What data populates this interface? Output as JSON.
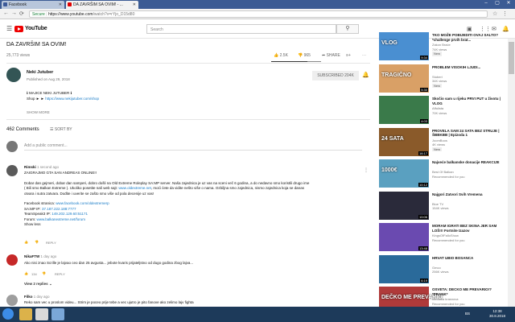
{
  "browser": {
    "tabs": [
      {
        "label": "Facebook",
        "fav": "#3b5998"
      },
      {
        "label": "DA ZAVRŠIM SA OVIM! - ...",
        "fav": "#e00000"
      }
    ],
    "address": {
      "secure": "Secure",
      "host": "https://www.youtube.com",
      "path": "/watch?v=rYjo_D15d80"
    }
  },
  "header": {
    "brand": "YouTube",
    "search_placeholder": "Search"
  },
  "video": {
    "title": "DA ZAVRŠIM SA OVIM!",
    "views": "25,773 views",
    "likes": "2.5K",
    "dislikes": "965",
    "share": "SHARE",
    "save": "SAVE",
    "like_ratio": 0.72
  },
  "channel": {
    "name": "Neki Jutuber",
    "published": "Published on Aug 29, 2018",
    "subscribe": "SUBSCRIBED",
    "subs": "204K"
  },
  "description": {
    "line1": "ℹ MAJICE NEKI JUTUBER ℹ",
    "line2_prefix": "Shop ► ►",
    "line2_link": "https://www.nekijutuber.com/shop",
    "show_more": "SHOW MORE"
  },
  "comments": {
    "count": "462 Comments",
    "sort": "SORT BY",
    "add_placeholder": "Add a public comment...",
    "items": [
      {
        "author": "Rimski",
        "time": "1 second ago",
        "lines": [
          "ZAIGRAJMO GTA SAN ANDREAS ONLINE!!",
          "",
          "Dobar dan gejmeri, dobar dan samperi, dobro došli na Old Extreme Roleplay SA:MP server. Naša zajednica je uz vas na sceni več 6 godina, a do nedavno smo koristili drugo ime",
          "( Bili smo Balkan Extreme ). Ukoliko posetite naš web sajt:",
          "otvara i sutra zatvara. Dođite i uverite se zašto smo više od pola decenije uz vas!"
        ],
        "web_link": "www.oldextreme.net",
        "line4_suffix": ", moći ćete da vidite nešto više o nama. Ozbiljna smo zajednica, nismo zajednica koja se danas",
        "fb_label": "Facebook stranica:",
        "fb_link": "www.facebook.com/oldextremerp",
        "ip_label": "SA:MP IP:",
        "ip_link": "37.187.222.188:7777",
        "ts_label": "TeamSpeak3 IP:",
        "ts_link": "149.202.129.60:51171",
        "forum_label": "Forum:",
        "forum_link": "www.balkanextreme.net/forum",
        "show_less": "Show less",
        "reply": "REPLY"
      },
      {
        "author": "NikaFTW",
        "time": "1 day ago",
        "text": "Ako nisi znao Scrille je lajvao ceo dan 25 avgusta... jebote kvaris prijateljstvo od dugo godina zbog lajva...",
        "likes": "134",
        "reply": "REPLY",
        "replies": "View 2 replies"
      },
      {
        "author": "Filko",
        "time": "1 day ago",
        "text": "Reko sam vec u proslom videu... Strim je poceo prije tebe a vec ujutro je pito fanove ako zelimo lajv fighta"
      }
    ]
  },
  "sidebar": [
    {
      "title": "TKO MOŽE POBIJEDITI OVAJ SALTO? *challenge prvih brat...",
      "channel": "Zakon Braće",
      "views": "74K views",
      "badge": "New",
      "dur": "9:34",
      "color": "#4a8fd1",
      "thumb_text": "VLOG"
    },
    {
      "title": "PROBLEM VISOKIH LJUDI...",
      "channel": "Stuberi",
      "views": "34K views",
      "badge": "New",
      "dur": "5:30",
      "color": "#d9a066",
      "thumb_text": "TRAGIČNO"
    },
    {
      "title": "Skočio sam u rijeku PRVI PUT u životu | VLOG",
      "channel": "Affulista",
      "views": "70K views",
      "badge": "",
      "dur": "4:03",
      "color": "#3a7a4a",
      "thumb_text": ""
    },
    {
      "title": "PROVELA SAM 24 SATA BEZ STRUJE | ŠBBKBB | Epizoda 1",
      "channel": "JoomBoos",
      "views": "4K views",
      "badge": "New",
      "dur": "16:17",
      "color": "#8a5a2a",
      "thumb_text": "24 SATA"
    },
    {
      "title": "Najveće balkanske donacije REAKCIJE",
      "channel": "Best Of Balkan",
      "views": "Recommended for you",
      "badge": "",
      "dur": "10:12",
      "color": "#5aa0c0",
      "thumb_text": "1000€"
    },
    {
      "title": "Najgori Zatvori Svih Vremena",
      "channel": "Blue TV",
      "views": "154K views",
      "badge": "",
      "dur": "10:06",
      "color": "#2a2a3a",
      "thumb_text": ""
    },
    {
      "title": "MORAM IGRATI BEZ SKINA JER SAM LOŠ!!! Fortnite Izazov",
      "channel": "KingsOfFalloShow",
      "views": "Recommended for you",
      "badge": "",
      "dur": "13:48",
      "color": "#6a4ab0",
      "thumb_text": ""
    },
    {
      "title": "HRVAT UBIO BOSANCA",
      "channel": "Gmco",
      "views": "256K views",
      "badge": "",
      "dur": "6:19",
      "color": "#2a6a9a",
      "thumb_text": ""
    },
    {
      "title": "OSVETA: DECKO ME PREVARIO!? *PRANK*",
      "channel": "veronika krasnova",
      "views": "Recommended for you",
      "badge": "",
      "dur": "9:02",
      "color": "#b03a3a",
      "thumb_text": "DEČKO ME PREVARIO"
    }
  ],
  "taskbar": {
    "lang": "BS",
    "time": "12:38",
    "date": "30.8.2018"
  }
}
